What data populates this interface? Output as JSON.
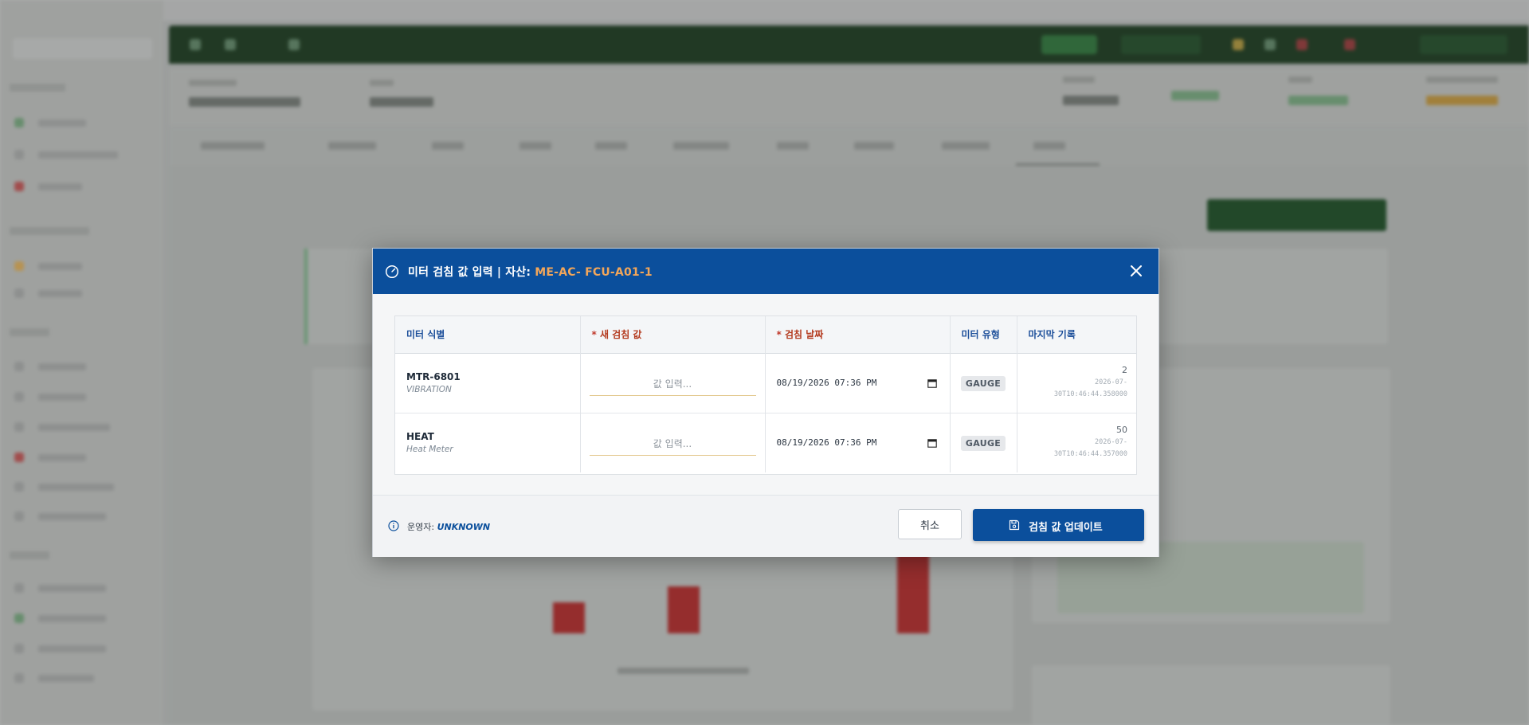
{
  "modal": {
    "title_prefix": "미터 검침 값 입력 | 자산: ",
    "asset_id": "ME-AC- FCU-A01-1",
    "columns": {
      "meter": "미터 식별",
      "new_value_req": "*",
      "new_value": " 새 검침 값",
      "date_req": "*",
      "date": " 검침 날짜",
      "type": "미터 유형",
      "last": "마지막 기록"
    },
    "rows": [
      {
        "code": "MTR-6801",
        "name": "VIBRATION",
        "placeholder": "값 입력...",
        "date": "08/19/2026  07:36  PM",
        "type": "GAUGE",
        "last_value": "2",
        "last_ts_1": "2026-07-",
        "last_ts_2": "30T10:46:44.358000"
      },
      {
        "code": "HEAT",
        "name": "Heat Meter",
        "placeholder": "값 입력...",
        "date": "08/19/2026  07:36  PM",
        "type": "GAUGE",
        "last_value": "50",
        "last_ts_1": "2026-07-",
        "last_ts_2": "30T10:46:44.357000"
      }
    ],
    "footer": {
      "operator_label": "운영자: ",
      "operator_value": "UNKNOWN",
      "cancel_label": "취소",
      "update_label": "검침 값 업데이트"
    }
  },
  "colors": {
    "header_bg": "#0b4f9c",
    "asset_accent": "#f2a65a",
    "required": "#b33a1e",
    "primary": "#0b4f9c"
  },
  "icons": [
    "gauge-icon",
    "close-icon",
    "calendar-icon",
    "info-icon",
    "save-icon"
  ]
}
